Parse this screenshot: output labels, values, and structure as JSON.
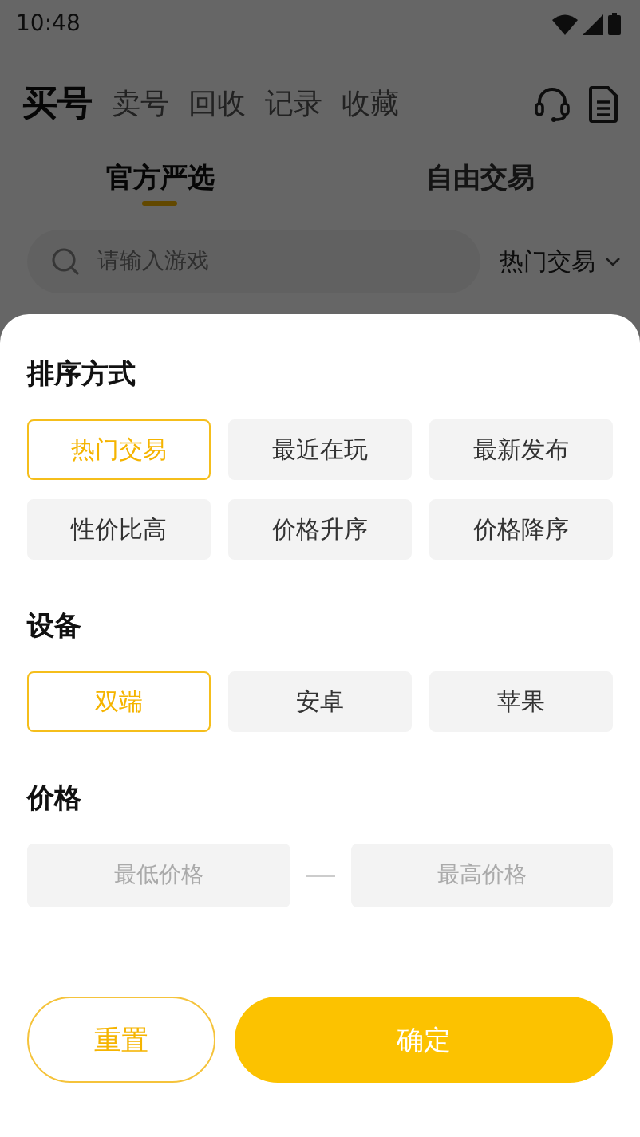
{
  "status_bar": {
    "time": "10:48"
  },
  "top_tabs": [
    {
      "label": "买号",
      "selected": true
    },
    {
      "label": "卖号",
      "selected": false
    },
    {
      "label": "回收",
      "selected": false
    },
    {
      "label": "记录",
      "selected": false
    },
    {
      "label": "收藏",
      "selected": false
    }
  ],
  "sub_tabs": [
    {
      "label": "官方严选",
      "selected": true
    },
    {
      "label": "自由交易",
      "selected": false
    }
  ],
  "search": {
    "placeholder": "请输入游戏"
  },
  "sort_dropdown": {
    "label": "热门交易"
  },
  "sheet": {
    "sections": [
      {
        "title": "排序方式",
        "kind": "options",
        "options": [
          {
            "label": "热门交易",
            "selected": true
          },
          {
            "label": "最近在玩",
            "selected": false
          },
          {
            "label": "最新发布",
            "selected": false
          },
          {
            "label": "性价比高",
            "selected": false
          },
          {
            "label": "价格升序",
            "selected": false
          },
          {
            "label": "价格降序",
            "selected": false
          }
        ]
      },
      {
        "title": "设备",
        "kind": "options",
        "options": [
          {
            "label": "双端",
            "selected": true
          },
          {
            "label": "安卓",
            "selected": false
          },
          {
            "label": "苹果",
            "selected": false
          }
        ]
      },
      {
        "title": "价格",
        "kind": "range",
        "min_placeholder": "最低价格",
        "max_placeholder": "最高价格"
      }
    ],
    "buttons": [
      {
        "label": "重置",
        "kind": "outline"
      },
      {
        "label": "确定",
        "kind": "primary"
      }
    ]
  }
}
